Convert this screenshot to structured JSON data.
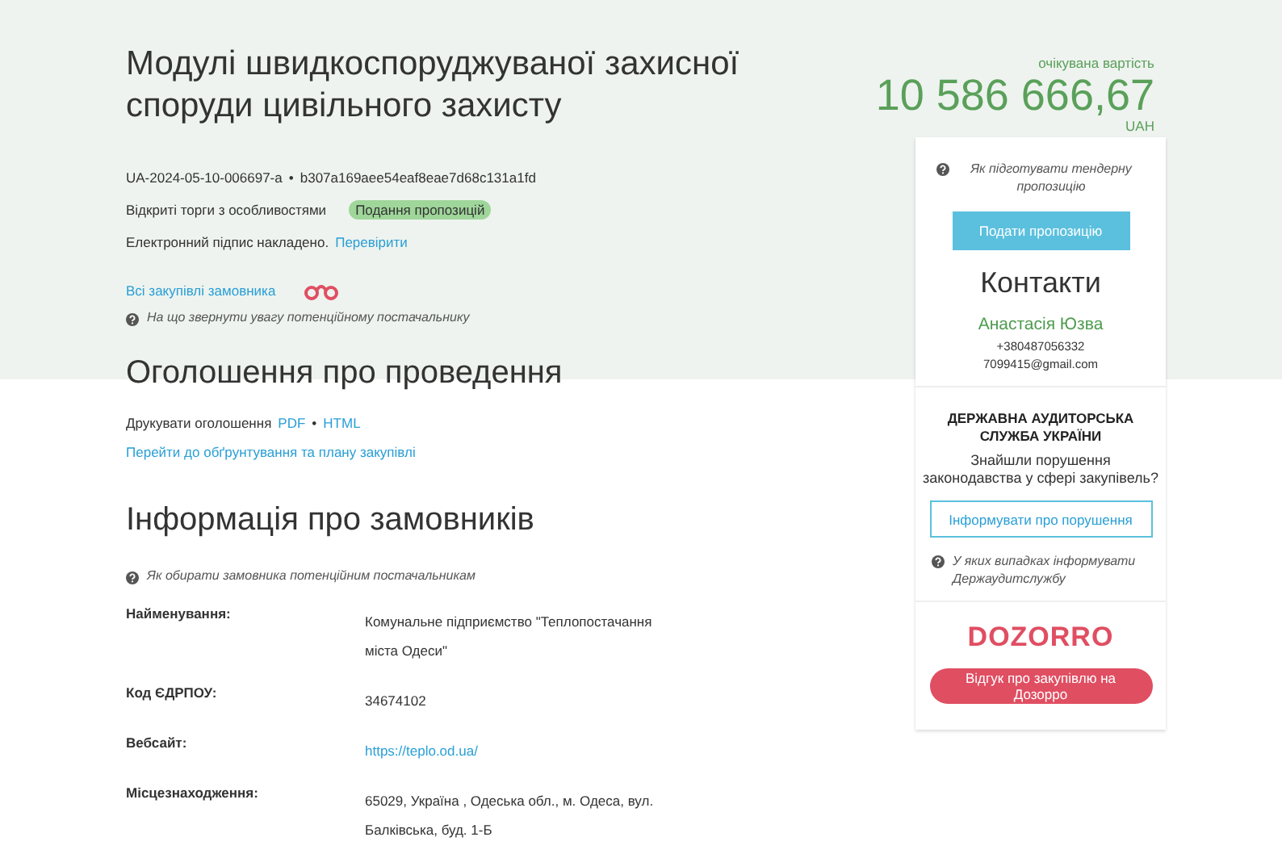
{
  "title": "Модулі швидкоспоруджуваної захисної споруди цивільного захисту",
  "tender_id": "UA-2024-05-10-006697-a",
  "id_separator": "•",
  "hash": "b307a169aee54eaf8eae7d68c131a1fd",
  "procedure": "Відкриті торги з особливостями",
  "status": "Подання пропозицій",
  "signature": {
    "text": "Електронний підпис накладено.",
    "link": "Перевірити"
  },
  "customer_link": "Всі закупівлі замовника",
  "supplier_hint": "На що звернути увагу потенційному постачальнику",
  "price": {
    "label": "очікувана вартість",
    "amount": "10 586 666,67",
    "currency": "UAH"
  },
  "card": {
    "tender_hint": "Як підготувати тендерну пропозицію",
    "submit_button": "Подати пропозицію",
    "contacts_title": "Контакти",
    "contact_name": "Анастасія Юзва",
    "phone": "+380487056332",
    "email": "7099415@gmail.com",
    "audit_title": "ДЕРЖАВНА АУДИТОРСЬКА СЛУЖБА УКРАЇНИ",
    "audit_question": "Знайшли порушення законодавства у сфері закупівель?",
    "audit_button": "Інформувати про порушення",
    "audit_hint": "У яких випадках інформувати Держаудитслужбу",
    "dozorro_logo": "DOZORRO",
    "dozorro_button": "Відгук про закупівлю на Дозорро"
  },
  "announcement": {
    "heading": "Оголошення про проведення",
    "print_label": "Друкувати оголошення",
    "formats": [
      "PDF",
      "HTML"
    ],
    "format_separator": "•",
    "plan_link": "Перейти до обґрунтування та плану закупівлі"
  },
  "customers": {
    "heading": "Інформація про замовників",
    "hint": "Як обирати замовника потенційним постачальникам",
    "rows": [
      {
        "label": "Найменування:",
        "value": "Комунальне підприємство \"Теплопостачання міста Одеси\"",
        "kind": "text"
      },
      {
        "label": "Код ЄДРПОУ:",
        "value": "34674102",
        "kind": "text"
      },
      {
        "label": "Вебсайт:",
        "value": "https://teplo.od.ua/",
        "kind": "link"
      },
      {
        "label": "Місцезнаходження:",
        "value": "65029, Україна , Одеська обл., м. Одеса, вул. Балківська, буд. 1-Б",
        "kind": "text"
      }
    ]
  }
}
